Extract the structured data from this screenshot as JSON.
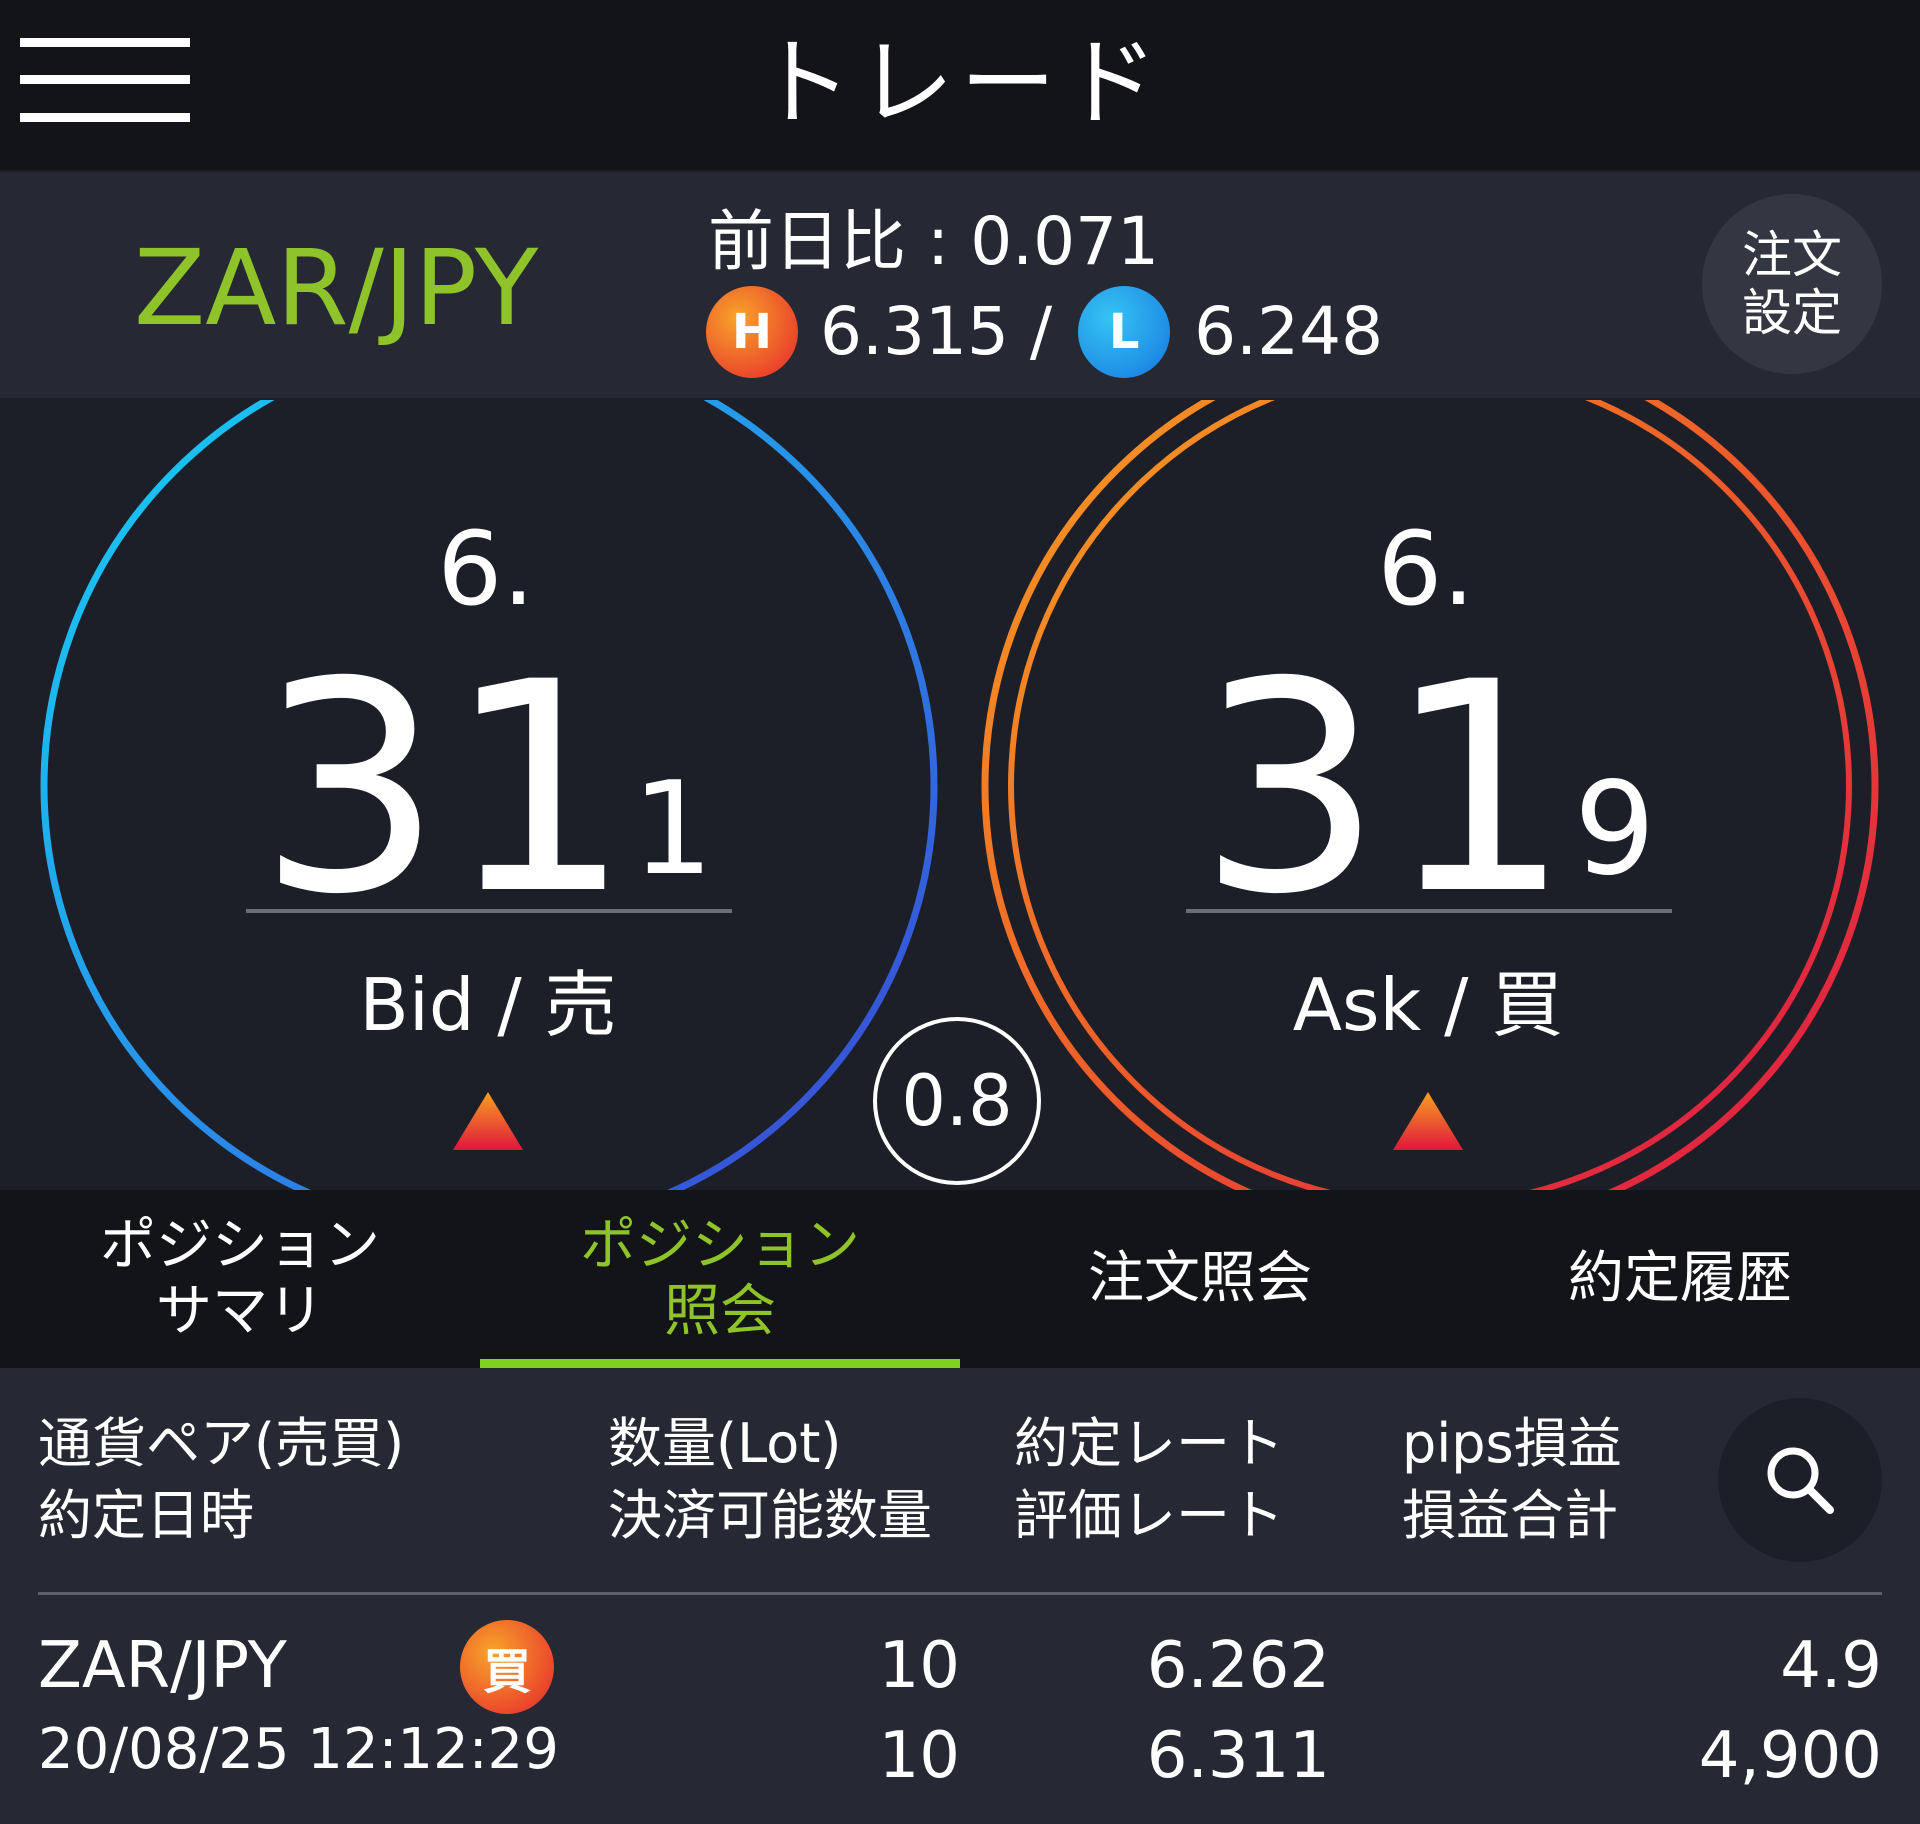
{
  "header": {
    "title": "トレード",
    "menu_icon": "hamburger-menu-icon"
  },
  "pair_bar": {
    "pair": "ZAR/JPY",
    "change_label": "前日比 : 0.071",
    "high_badge": "H",
    "high_value": "6.315 /",
    "low_badge": "L",
    "low_value": "6.248",
    "order_settings_line1": "注文",
    "order_settings_line2": "設定"
  },
  "bid": {
    "prefix": "6.",
    "big": "31",
    "last": "1",
    "label": "Bid / 売",
    "direction_icon": "up-triangle-icon"
  },
  "ask": {
    "prefix": "6.",
    "big": "31",
    "last": "9",
    "label": "Ask / 買",
    "direction_icon": "up-triangle-icon"
  },
  "spread": "0.8",
  "tabs": [
    {
      "line1": "ポジション",
      "line2": "サマリ",
      "active": false
    },
    {
      "line1": "ポジション",
      "line2": "照会",
      "active": true
    },
    {
      "line1": "注文照会",
      "line2": "",
      "active": false
    },
    {
      "line1": "約定履歴",
      "line2": "",
      "active": false
    }
  ],
  "table": {
    "headers": {
      "col1_line1": "通貨ペア(売買)",
      "col1_line2": "約定日時",
      "col2_line1": "数量(Lot)",
      "col2_line2": "決済可能数量",
      "col3_line1": "約定レート",
      "col3_line2": "評価レート",
      "col4_line1": "pips損益",
      "col4_line2": "損益合計"
    },
    "search_icon": "search-icon",
    "rows": [
      {
        "pair": "ZAR/JPY",
        "side": "買",
        "datetime": "20/08/25 12:12:29",
        "lot": "10",
        "closable_lot": "10",
        "exec_rate": "6.262",
        "eval_rate": "6.311",
        "pips": "4.9",
        "pnl_total": "4,900"
      }
    ]
  },
  "colors": {
    "accent_green": "#8fc32a",
    "bid_ring": "#1f8fe6",
    "ask_ring": "#ec4a2b",
    "background": "#1d1f28"
  }
}
